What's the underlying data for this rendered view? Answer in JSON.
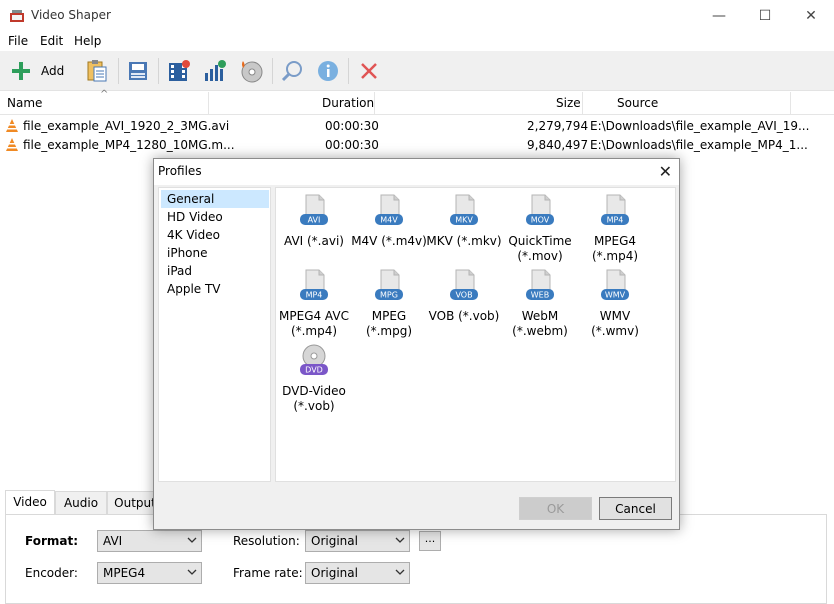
{
  "window": {
    "title": "Video Shaper",
    "minimize_glyph": "—",
    "maximize_glyph": "☐",
    "close_glyph": "✕"
  },
  "menu": [
    "File",
    "Edit",
    "Help"
  ],
  "toolbar": {
    "add_label": "Add",
    "icons": [
      "add-icon",
      "paste-icon",
      "save-icon",
      "video-effects-icon",
      "audio-levels-icon",
      "burn-disc-icon",
      "search-icon",
      "info-icon",
      "delete-icon"
    ]
  },
  "file_list": {
    "columns": [
      "Name",
      "Duration",
      "Size",
      "Source"
    ],
    "rows": [
      {
        "name": "file_example_AVI_1920_2_3MG.avi",
        "duration": "00:00:30",
        "size": "2,279,794",
        "source": "E:\\Downloads\\file_example_AVI_19..."
      },
      {
        "name": "file_example_MP4_1280_10MG.m...",
        "duration": "00:00:30",
        "size": "9,840,497",
        "source": "E:\\Downloads\\file_example_MP4_1..."
      }
    ]
  },
  "settings": {
    "tabs": [
      "Video",
      "Audio",
      "Output"
    ],
    "active_tab": "Video",
    "format_label": "Format:",
    "format_value": "AVI",
    "encoder_label": "Encoder:",
    "encoder_value": "MPEG4",
    "resolution_label": "Resolution:",
    "resolution_value": "Original",
    "framerate_label": "Frame rate:",
    "framerate_value": "Original",
    "more_button": "..."
  },
  "dialog": {
    "title": "Profiles",
    "close_glyph": "✕",
    "categories": [
      "General",
      "HD Video",
      "4K Video",
      "iPhone",
      "iPad",
      "Apple TV"
    ],
    "selected_category": "General",
    "profiles": [
      {
        "badge": "AVI",
        "label": "AVI (*.avi)"
      },
      {
        "badge": "M4V",
        "label": "M4V (*.m4v)"
      },
      {
        "badge": "MKV",
        "label": "MKV (*.mkv)"
      },
      {
        "badge": "MOV",
        "label": "QuickTime\n(*.mov)"
      },
      {
        "badge": "MP4",
        "label": "MPEG4\n(*.mp4)"
      },
      {
        "badge": "MP4",
        "label": "MPEG4 AVC\n(*.mp4)"
      },
      {
        "badge": "MPG",
        "label": "MPEG\n(*.mpg)"
      },
      {
        "badge": "VOB",
        "label": "VOB (*.vob)"
      },
      {
        "badge": "WEB",
        "label": "WebM\n(*.webm)"
      },
      {
        "badge": "WMV",
        "label": "WMV\n(*.wmv)"
      },
      {
        "badge": "DVD",
        "label": "DVD-Video\n(*.vob)"
      }
    ],
    "ok_label": "OK",
    "cancel_label": "Cancel"
  },
  "colors": {
    "badge_blue": "#3a7bbf",
    "dvd_purple": "#7b57c8",
    "selection": "#cce8ff",
    "add_green": "#2e9e5b",
    "delete_red": "#e05454"
  }
}
